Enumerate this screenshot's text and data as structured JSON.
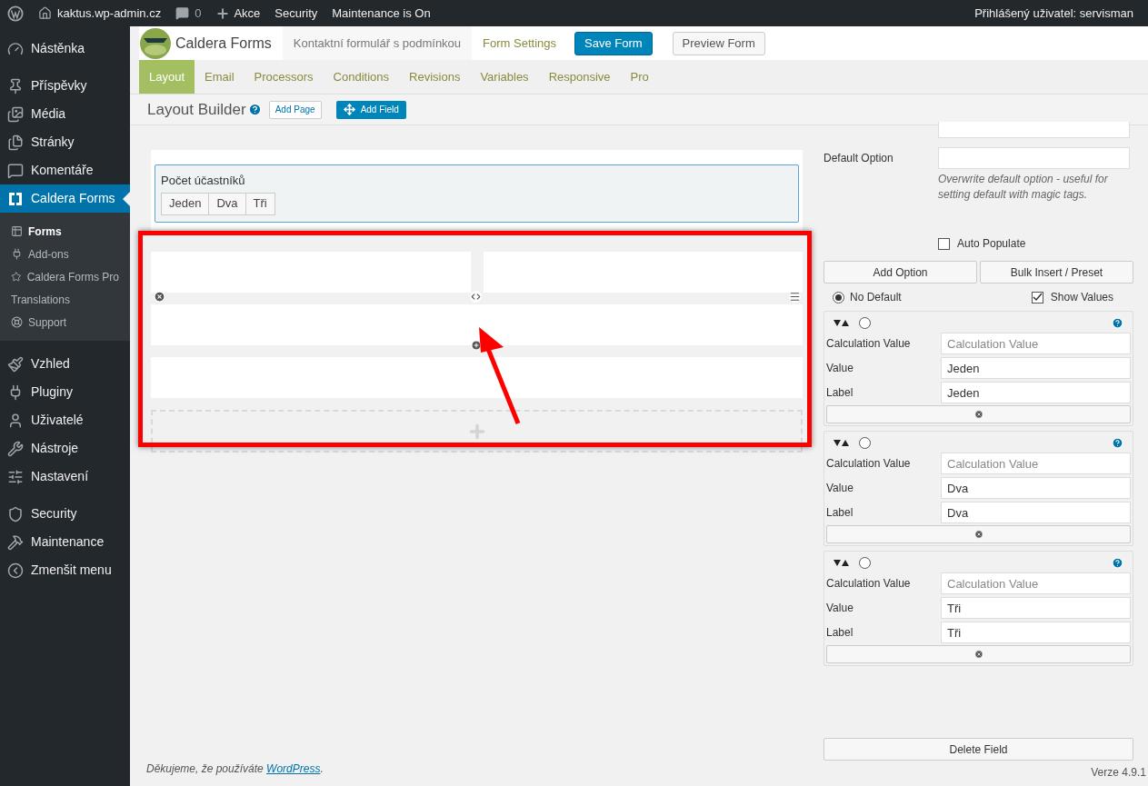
{
  "admin_bar": {
    "site": "kaktus.wp-admin.cz",
    "comments": "0",
    "new": "Akce",
    "items": [
      "Security",
      "Maintenance is On"
    ],
    "user": "Přihlášený uživatel: servisman"
  },
  "sidebar": {
    "groups": [
      [
        {
          "label": "Nástěnka",
          "selected": false
        }
      ],
      [
        {
          "label": "Příspěvky",
          "selected": false
        },
        {
          "label": "Média",
          "selected": false
        },
        {
          "label": "Stránky",
          "selected": false
        },
        {
          "label": "Komentáře",
          "selected": false
        },
        {
          "label": "Caldera Forms",
          "selected": true,
          "children": [
            {
              "label": "Forms",
              "selected": true
            },
            {
              "label": "Add-ons",
              "selected": false
            },
            {
              "label": "Caldera Forms Pro",
              "selected": false
            },
            {
              "label": "Translations",
              "selected": false
            },
            {
              "label": "Support",
              "selected": false
            }
          ]
        }
      ],
      [
        {
          "label": "Vzhled",
          "selected": false
        },
        {
          "label": "Pluginy",
          "selected": false
        },
        {
          "label": "Uživatelé",
          "selected": false
        },
        {
          "label": "Nástroje",
          "selected": false
        },
        {
          "label": "Nastavení",
          "selected": false
        }
      ],
      [
        {
          "label": "Security",
          "selected": false
        },
        {
          "label": "Maintenance",
          "selected": false
        },
        {
          "label": "Zmenšit menu",
          "selected": false
        }
      ]
    ]
  },
  "header": {
    "brand": "Caldera Forms",
    "form_name": "Kontaktní formulář s podmínkou",
    "settings_link": "Form Settings",
    "save_button": "Save Form",
    "preview_button": "Preview Form"
  },
  "tabs": [
    {
      "label": "Layout",
      "selected": true
    },
    {
      "label": "Email",
      "selected": false
    },
    {
      "label": "Processors",
      "selected": false
    },
    {
      "label": "Conditions",
      "selected": false
    },
    {
      "label": "Revisions",
      "selected": false
    },
    {
      "label": "Variables",
      "selected": false
    },
    {
      "label": "Responsive",
      "selected": false
    },
    {
      "label": "Pro",
      "selected": false
    }
  ],
  "builder": {
    "title": "Layout Builder",
    "add_page": "Add Page",
    "add_field": "Add Field",
    "field": {
      "label": "Počet účastníků",
      "selected": true,
      "options": [
        "Jeden",
        "Dva",
        "Tři"
      ]
    },
    "rows": [
      {
        "kind": "split"
      },
      {
        "kind": "full"
      },
      {
        "kind": "full"
      }
    ]
  },
  "panel": {
    "default_option": {
      "label": "Default Option",
      "help": "Overwrite default option - useful for setting default with magic tags."
    },
    "auto_populate": {
      "label": "Auto Populate",
      "checked": false
    },
    "add_option": "Add Option",
    "bulk_insert": "Bulk Insert / Preset",
    "no_default": {
      "label": "No Default",
      "selected": true
    },
    "show_values": {
      "label": "Show Values",
      "checked": true
    },
    "options": [
      {
        "selected": false,
        "calc_label": "Calculation Value",
        "calc_placeholder": "Calculation Value",
        "value_label": "Value",
        "value": "Jeden",
        "label_label": "Label",
        "label": "Jeden"
      },
      {
        "selected": false,
        "calc_label": "Calculation Value",
        "calc_placeholder": "Calculation Value",
        "value_label": "Value",
        "value": "Dva",
        "label_label": "Label",
        "label": "Dva"
      },
      {
        "selected": false,
        "calc_label": "Calculation Value",
        "calc_placeholder": "Calculation Value",
        "value_label": "Value",
        "value": "Tři",
        "label_label": "Label",
        "label": "Tři"
      }
    ],
    "delete_field": "Delete Field"
  },
  "footer": {
    "thanks": "Děkujeme, že používáte ",
    "link": "WordPress",
    "end": ".",
    "version": "Verze 4.9.1"
  }
}
